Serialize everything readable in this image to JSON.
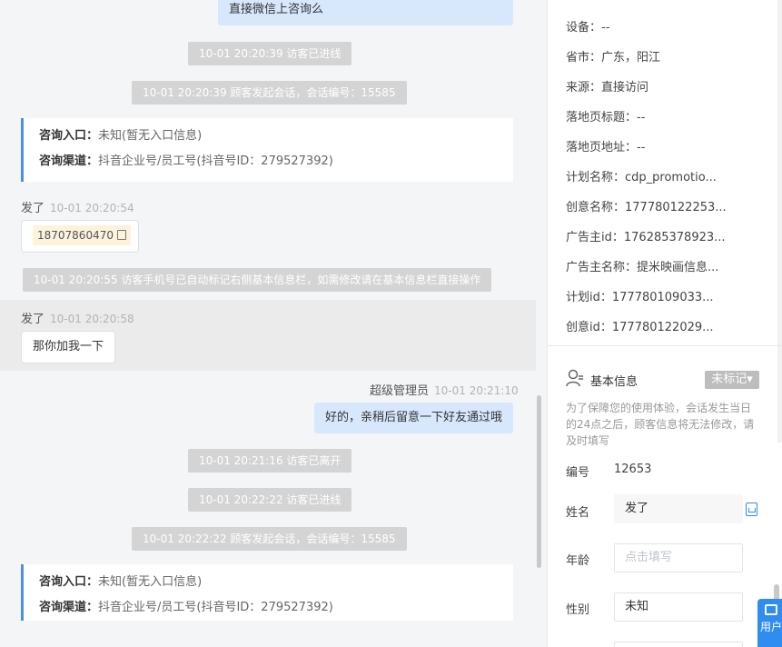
{
  "chat": {
    "top_bubble": "直接微信上咨询么",
    "sys1": "10-01 20:20:39 访客已进线",
    "sys2": "10-01 20:20:39 顾客发起会话，会话编号：15585",
    "card1": {
      "entry_label": "咨询入口：",
      "entry_value": "未知(暂无入口信息)",
      "channel_label": "咨询渠道：",
      "channel_value": "抖音企业号/员工号(抖音号ID：279527392)"
    },
    "msg1": {
      "sender": "发了",
      "time": "10-01 20:20:54",
      "phone": "18707860470"
    },
    "sys3": "10-01 20:20:55 访客手机号已自动标记右侧基本信息栏，如需修改请在基本信息栏直接操作",
    "msg2": {
      "sender": "发了",
      "time": "10-01 20:20:58",
      "text": "那你加我一下"
    },
    "agent": {
      "name": "超级管理员",
      "time": "10-01 20:21:10",
      "text": "好的，亲稍后留意一下好友通过哦"
    },
    "sys4": "10-01 20:21:16 访客已离开",
    "sys5": "10-01 20:22:22 访客已进线",
    "sys6": "10-01 20:22:22 顾客发起会话，会话编号：15585",
    "card2": {
      "entry_label": "咨询入口：",
      "entry_value": "未知(暂无入口信息)",
      "channel_label": "咨询渠道：",
      "channel_value": "抖音企业号/员工号(抖音号ID：279527392)"
    }
  },
  "side": {
    "details": [
      {
        "label": "设备：",
        "value": "--"
      },
      {
        "label": "省市：",
        "value": "广东，阳江"
      },
      {
        "label": "来源：",
        "value": "直接访问"
      },
      {
        "label": "落地页标题：",
        "value": "--"
      },
      {
        "label": "落地页地址：",
        "value": "--"
      },
      {
        "label": "计划名称：",
        "value": "cdp_promotio..."
      },
      {
        "label": "创意名称：",
        "value": "177780122253..."
      },
      {
        "label": "广告主id：",
        "value": "176285378923..."
      },
      {
        "label": "广告主名称：",
        "value": "提米映画信息..."
      },
      {
        "label": "计划id：",
        "value": "177780109033..."
      },
      {
        "label": "创意id：",
        "value": "177780122029..."
      }
    ],
    "basic": {
      "title": "基本信息",
      "mark": "未标记▾",
      "note": "为了保障您的使用体验，会话发生当日的24点之后，顾客信息将无法修改，请及时填写",
      "id_label": "编号",
      "id_value": "12653",
      "name_label": "姓名",
      "name_value": "发了",
      "age_label": "年龄",
      "age_placeholder": "点击填写",
      "gender_label": "性别",
      "gender_value": "未知"
    },
    "float_label": "用户"
  },
  "colors": {
    "accent": "#2f8cf0",
    "bubble_agent": "#d8e8fc",
    "system_msg": "#d4d4d4",
    "card_bar": "#4a90e2"
  }
}
